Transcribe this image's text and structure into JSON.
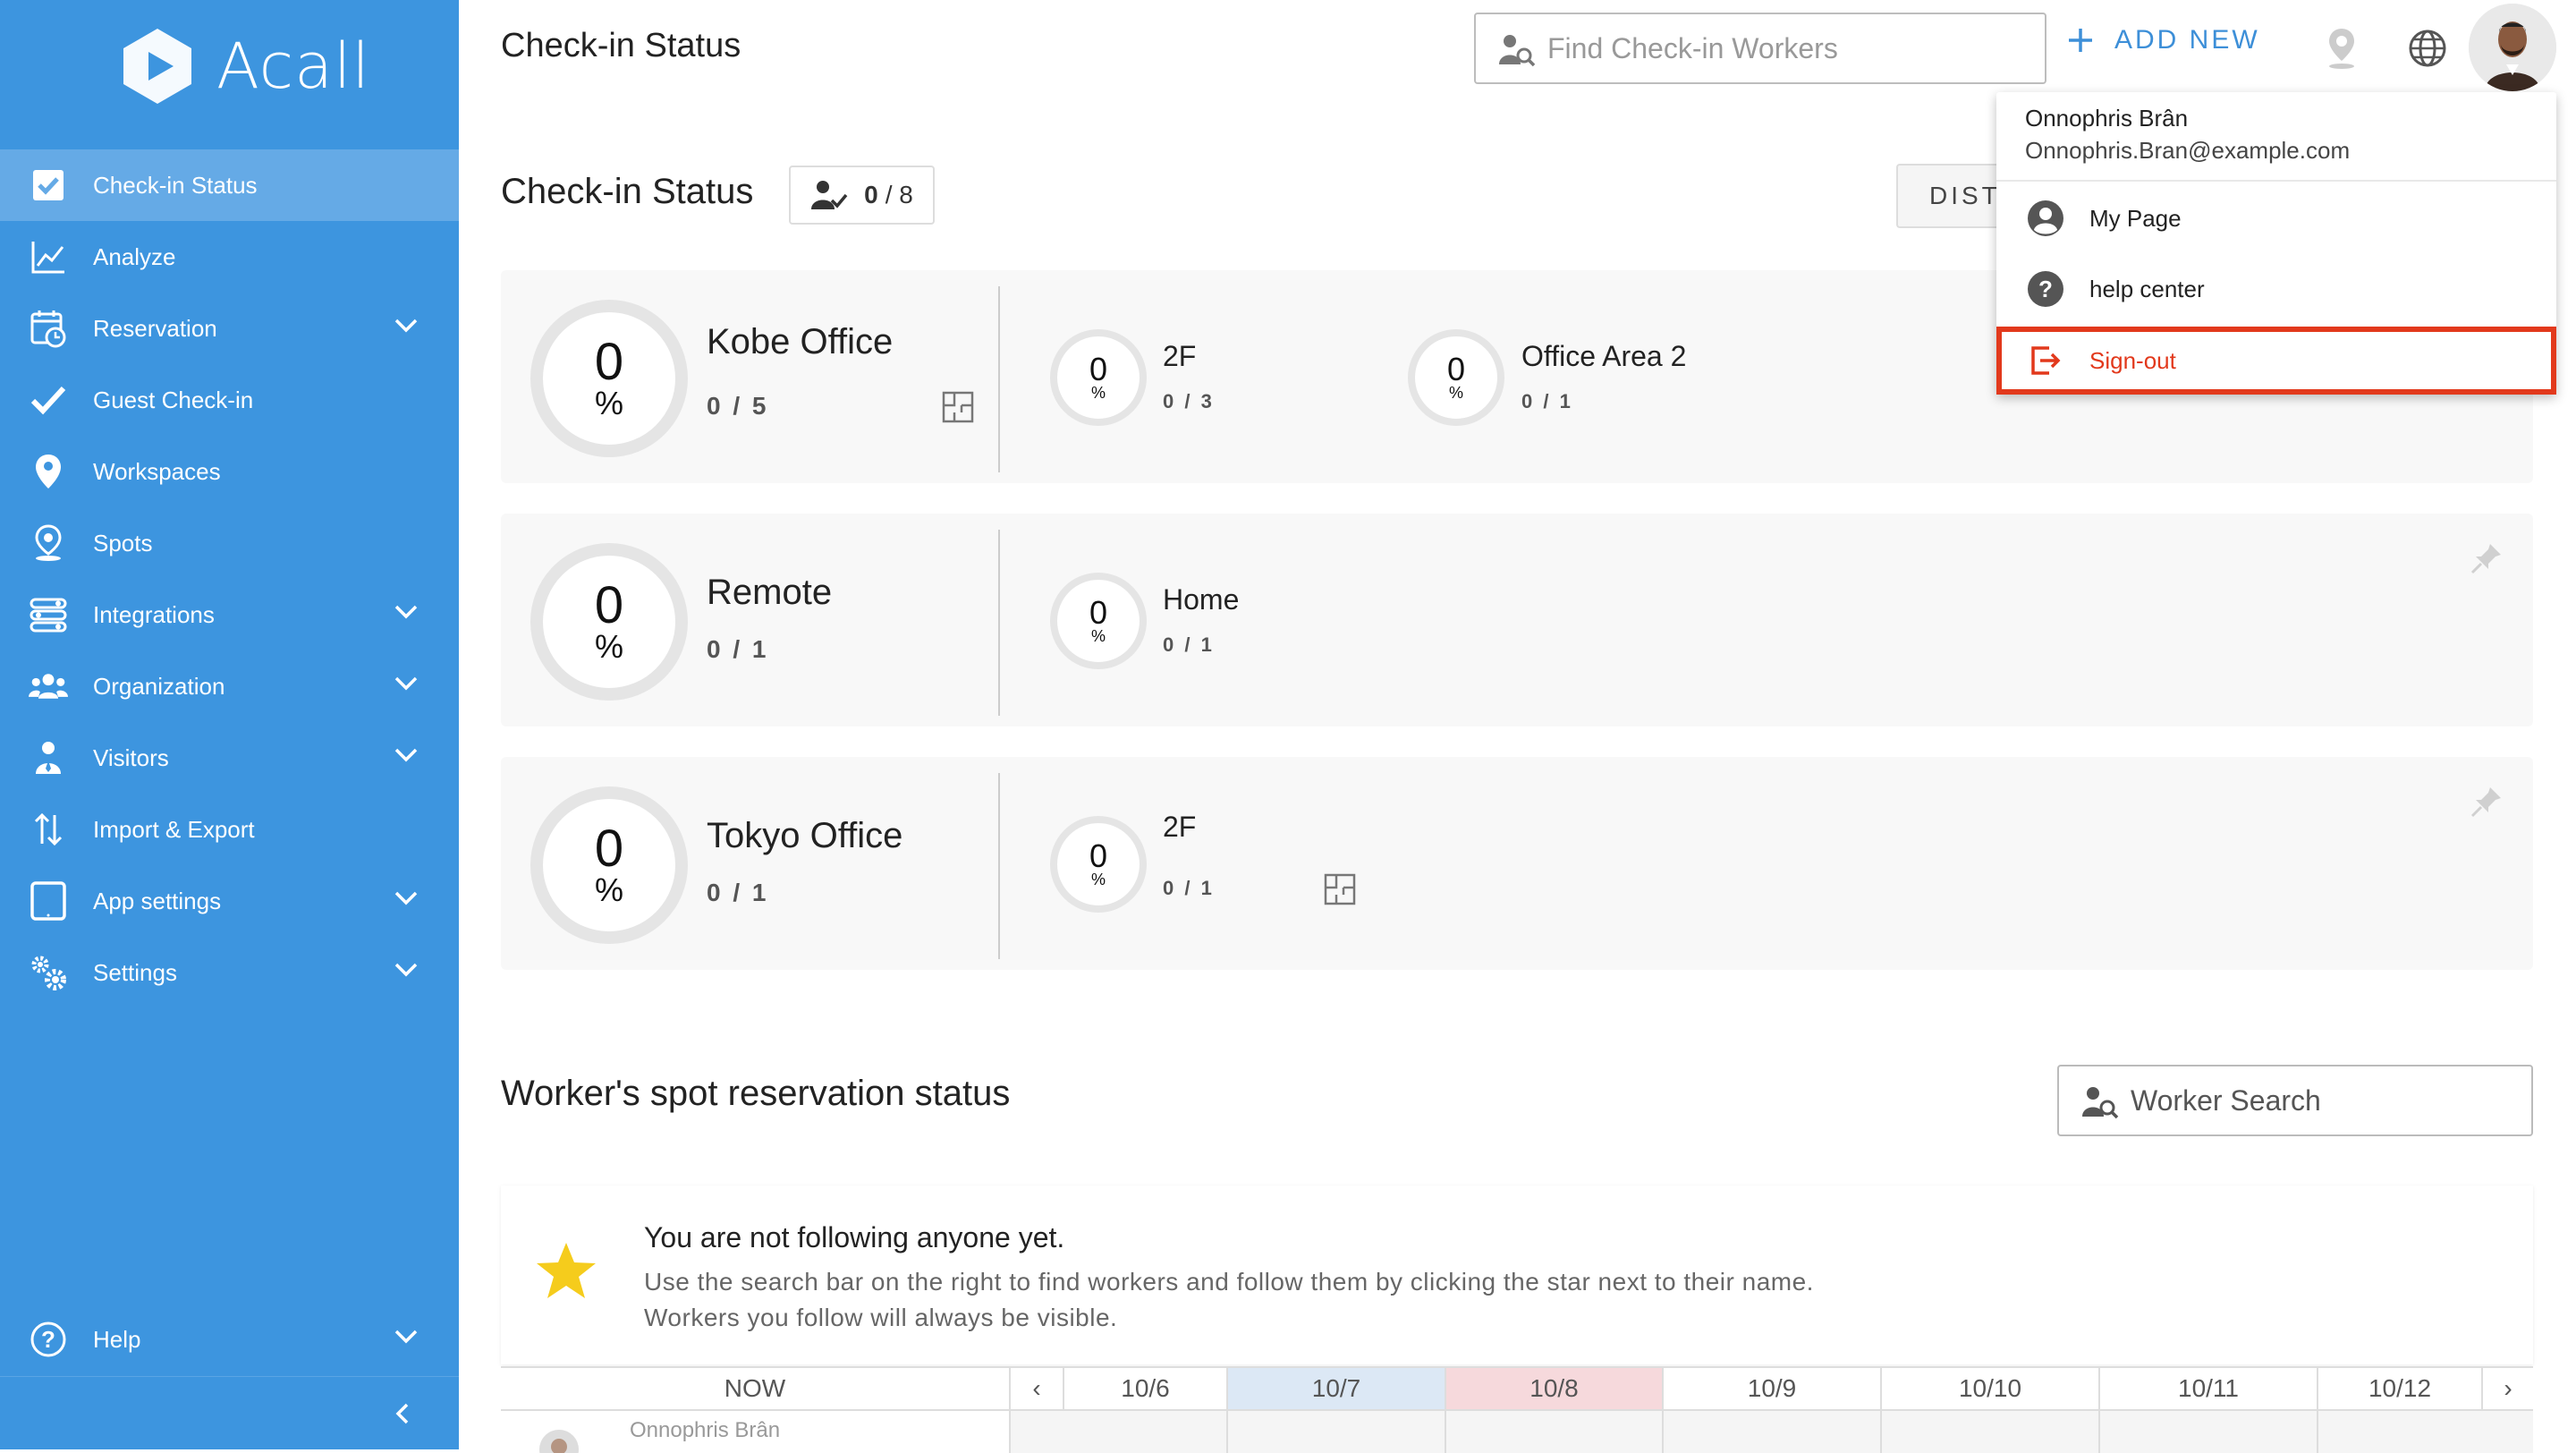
{
  "app": {
    "name": "Acall"
  },
  "sidebar": {
    "items": [
      {
        "label": "Check-in Status"
      },
      {
        "label": "Analyze"
      },
      {
        "label": "Reservation"
      },
      {
        "label": "Guest Check-in"
      },
      {
        "label": "Workspaces"
      },
      {
        "label": "Spots"
      },
      {
        "label": "Integrations"
      },
      {
        "label": "Organization"
      },
      {
        "label": "Visitors"
      },
      {
        "label": "Import & Export"
      },
      {
        "label": "App settings"
      },
      {
        "label": "Settings"
      }
    ],
    "help_label": "Help"
  },
  "topbar": {
    "title": "Check-in Status",
    "search_placeholder": "Find Check-in Workers",
    "add_new_label": "ADD NEW"
  },
  "main": {
    "section_title": "Check-in Status",
    "count_value": "0",
    "count_total": "/ 8",
    "distribute_label": "DISTI"
  },
  "locations": [
    {
      "name": "Kobe Office",
      "percent": "0",
      "unit": "%",
      "count": "0 / 5",
      "subs": [
        {
          "name": "2F",
          "percent": "0",
          "unit": "%",
          "count": "0 / 3"
        },
        {
          "name": "Office Area 2",
          "percent": "0",
          "unit": "%",
          "count": "0 / 1"
        }
      ]
    },
    {
      "name": "Remote",
      "percent": "0",
      "unit": "%",
      "count": "0 / 1",
      "subs": [
        {
          "name": "Home",
          "percent": "0",
          "unit": "%",
          "count": "0 / 1"
        }
      ]
    },
    {
      "name": "Tokyo Office",
      "percent": "0",
      "unit": "%",
      "count": "0 / 1",
      "subs": [
        {
          "name": "2F",
          "percent": "0",
          "unit": "%",
          "count": "0 / 1"
        }
      ]
    }
  ],
  "user_menu": {
    "name": "Onnophris Brân",
    "email": "Onnophris.Bran@example.com",
    "items": [
      {
        "label": "My Page"
      },
      {
        "label": "help center"
      },
      {
        "label": "Sign-out"
      }
    ]
  },
  "workers": {
    "title": "Worker's spot reservation status",
    "search_placeholder": "Worker Search",
    "empty_title": "You are not following anyone yet.",
    "empty_line1": "Use the search bar on the right to find workers and follow them by clicking the star next to their name.",
    "empty_line2": "Workers you follow will always be visible.",
    "table": {
      "now_label": "NOW",
      "prev_label": "‹",
      "next_label": "›",
      "dates": [
        "10/6",
        "10/7",
        "10/8",
        "10/9",
        "10/10",
        "10/11",
        "10/12"
      ],
      "rows": [
        {
          "name": "Onnophris Brân"
        }
      ]
    }
  },
  "colors": {
    "sidebar": "#3d95df",
    "accent": "#3d8fd8",
    "signout": "#e2391c",
    "today": "#dce8f5",
    "holiday": "#f6d9dc"
  }
}
